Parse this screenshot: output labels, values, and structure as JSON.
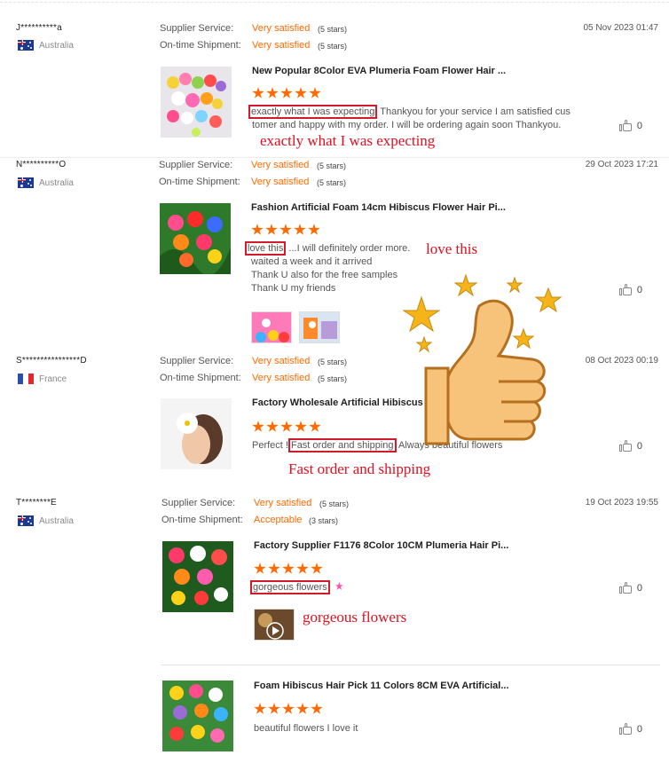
{
  "labels": {
    "supplier_service": "Supplier Service:",
    "on_time_shipment": "On-time Shipment:"
  },
  "colors": {
    "accent": "#ff6a00",
    "highlight_box": "#d11a2a",
    "annotation_text": "#e0101e"
  },
  "reviews": [
    {
      "user": "J**********a",
      "country": "Australia",
      "flag": "australia-flag-icon",
      "supplier_service": "Very satisfied",
      "supplier_stars": "(5 stars)",
      "shipment": "Very satisfied",
      "shipment_stars": "(5 stars)",
      "date": "05 Nov 2023 01:47",
      "product_title": "New Popular 8Color EVA Plumeria Foam Flower Hair ...",
      "rating": 5,
      "comment_highlight": "exactly what I was expecting",
      "comment_line1": " Thankyou for your service I am satisfied cus",
      "comment_line2": "tomer and happy with my order. I will be ordering again soon Thankyou.",
      "annotation": "exactly what I was expecting",
      "likes": "0"
    },
    {
      "user": "N**********O",
      "country": "Australia",
      "flag": "australia-flag-icon",
      "supplier_service": "Very satisfied",
      "supplier_stars": "(5 stars)",
      "shipment": "Very satisfied",
      "shipment_stars": "(5 stars)",
      "date": "29 Oct 2023 17:21",
      "product_title": "Fashion Artificial Foam 14cm Hibiscus Flower Hair Pi...",
      "rating": 5,
      "comment_highlight": "love this",
      "comment_line1": " ...I will definitely order more.",
      "comment_line2": "waited a week and it arrived",
      "comment_line3": "Thank U also for the free samples",
      "comment_line4": "Thank U my friends",
      "annotation": "love this",
      "likes": "0"
    },
    {
      "user": "S****************D",
      "country": "France",
      "flag": "france-flag-icon",
      "supplier_service": "Very satisfied",
      "supplier_stars": "(5 stars)",
      "shipment": "Very satisfied",
      "shipment_stars": "(5 stars)",
      "date": "08 Oct 2023 00:19",
      "product_title": "Factory Wholesale Artificial Hibiscus la",
      "rating": 5,
      "comment_prefix": "Perfect !",
      "comment_highlight": "Fast order and shipping",
      "comment_suffix": " Always beautiful flowers",
      "annotation": "Fast order and shipping",
      "likes": "0"
    },
    {
      "user": "T********E",
      "country": "Australia",
      "flag": "australia-flag-icon",
      "supplier_service": "Very satisfied",
      "supplier_stars": "(5 stars)",
      "shipment": "Acceptable",
      "shipment_stars": "(3 stars)",
      "date": "19 Oct 2023 19:55",
      "product_title": "Factory Supplier F1176 8Color 10CM Plumeria Hair Pi...",
      "rating": 5,
      "comment_highlight": "gorgeous flowers",
      "annotation": "gorgeous flowers",
      "likes": "0"
    },
    {
      "product_title": "Foam Hibiscus Hair Pick 11 Colors 8CM EVA Artificial...",
      "rating": 5,
      "comment": "beautiful flowers I love it",
      "likes": "0"
    }
  ],
  "overlay": {
    "icon": "thumbs-up-icon"
  }
}
